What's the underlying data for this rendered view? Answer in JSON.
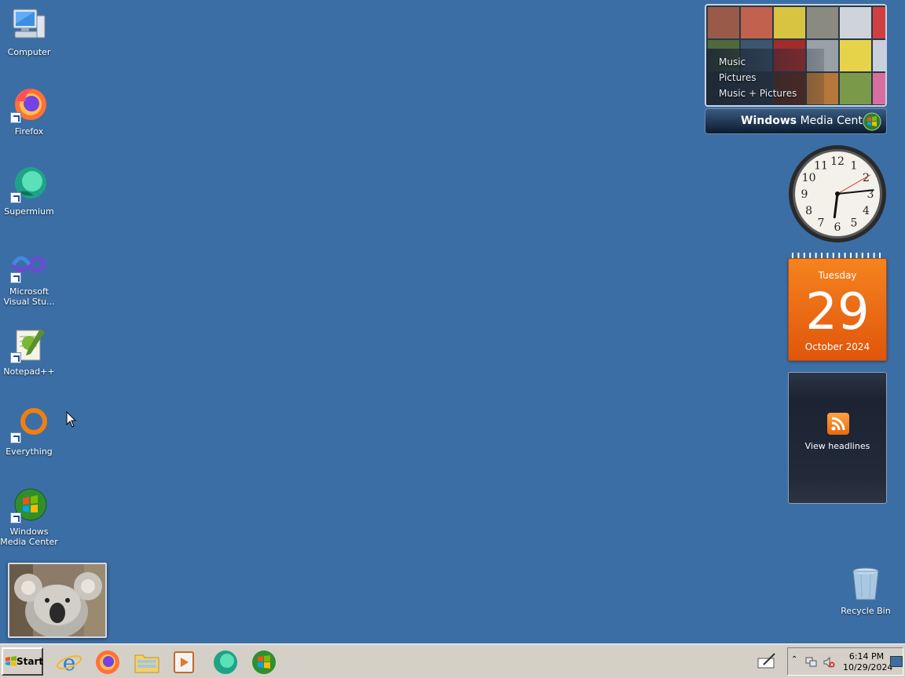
{
  "desktop": {
    "icons": [
      {
        "label": "Computer"
      },
      {
        "label": "Firefox"
      },
      {
        "label": "Supermium"
      },
      {
        "label": "Microsoft Visual Stu..."
      },
      {
        "label": "Notepad++"
      },
      {
        "label": "Everything"
      },
      {
        "label": "Windows Media Center"
      }
    ],
    "recycle_bin": "Recycle Bin",
    "background_color": "#3b6ea5"
  },
  "gadgets": {
    "media_center": {
      "items": [
        "Music",
        "Pictures",
        "Music + Pictures"
      ],
      "title_bold": "Windows",
      "title_rest": " Media Center"
    },
    "clock": {
      "hour": 6,
      "minute": 14,
      "second": 10
    },
    "calendar": {
      "day_of_week": "Tuesday",
      "day": "29",
      "month_year": "October 2024"
    },
    "feed": {
      "action": "View headlines"
    }
  },
  "taskbar": {
    "start_label": "Start",
    "quick_launch": [
      "internet-explorer",
      "firefox",
      "file-explorer",
      "media-player",
      "supermium",
      "windows-media-center"
    ],
    "clock_time": "6:14 PM",
    "clock_date": "10/29/2024"
  }
}
